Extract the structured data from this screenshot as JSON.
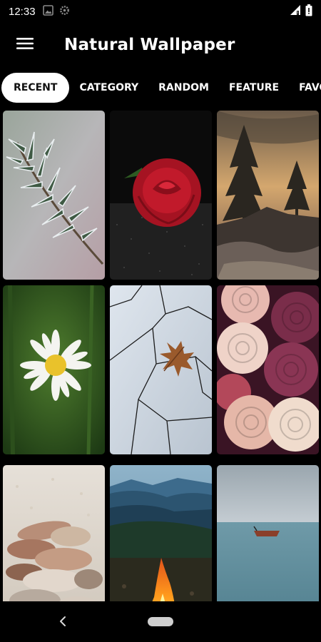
{
  "status": {
    "time": "12:33",
    "left_icons": [
      "gallery-icon",
      "gear-icon"
    ],
    "right_icons": [
      "signal-icon",
      "battery-icon"
    ]
  },
  "app_bar": {
    "title": "Natural Wallpaper",
    "menu_icon": "hamburger-menu-icon"
  },
  "tabs": [
    {
      "label": "RECENT",
      "active": true
    },
    {
      "label": "CATEGORY",
      "active": false
    },
    {
      "label": "RANDOM",
      "active": false
    },
    {
      "label": "FEATURE",
      "active": false
    },
    {
      "label": "FAVO",
      "active": false
    }
  ],
  "wallpapers": [
    {
      "subject": "frosted-plant"
    },
    {
      "subject": "red-rose"
    },
    {
      "subject": "pine-trees-sunset"
    },
    {
      "subject": "daisy-flower"
    },
    {
      "subject": "autumn-leaf-on-ice"
    },
    {
      "subject": "roses-bouquet"
    },
    {
      "subject": "beach-pebbles"
    },
    {
      "subject": "campfire-mountains"
    },
    {
      "subject": "boat-on-sea"
    }
  ],
  "nav": {
    "back_icon": "back-chevron-icon",
    "home_icon": "home-pill-icon"
  },
  "colors": {
    "background": "#000000",
    "tab_active_bg": "#ffffff",
    "tab_active_text": "#111111",
    "text": "#ffffff"
  }
}
